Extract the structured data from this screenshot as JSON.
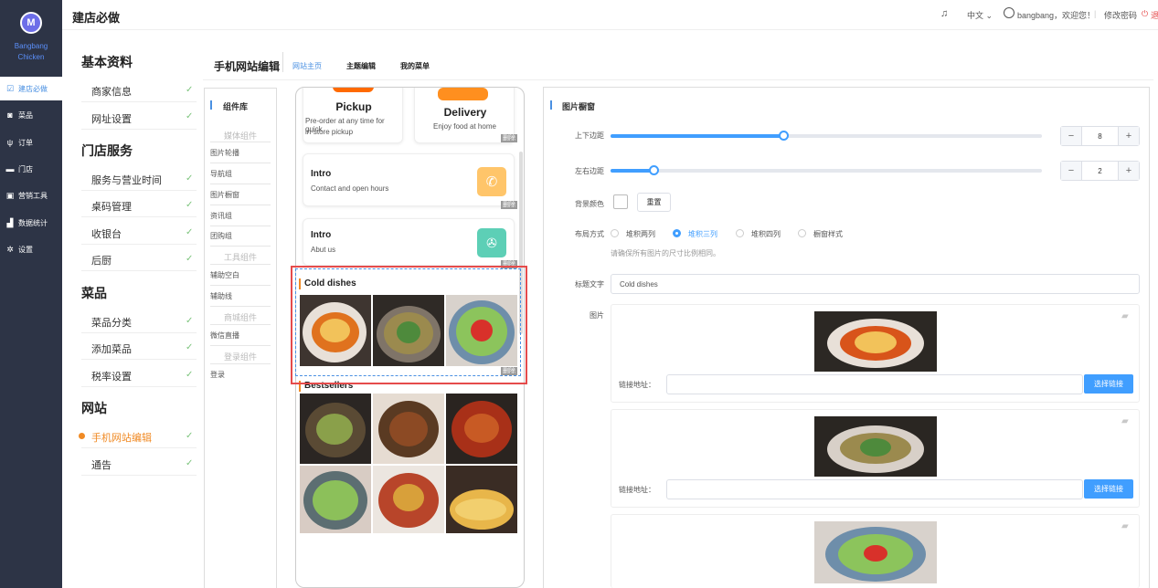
{
  "nav": {
    "brand_line1": "Bangbang",
    "brand_line2": "Chicken",
    "logo_letter": "M",
    "items": [
      {
        "icon": "check-square-icon",
        "label": "建店必做",
        "active": true
      },
      {
        "icon": "dish-icon",
        "label": "菜品"
      },
      {
        "icon": "utensils-icon",
        "label": "订单"
      },
      {
        "icon": "store-icon",
        "label": "门店"
      },
      {
        "icon": "gift-icon",
        "label": "营销工具"
      },
      {
        "icon": "chart-icon",
        "label": "数据统计"
      },
      {
        "icon": "gear-icon",
        "label": "设置"
      }
    ]
  },
  "topbar": {
    "title": "建店必做",
    "language": "中文",
    "user_greeting": "bangbang，欢迎您！",
    "change_password": "修改密码",
    "logout": "退"
  },
  "sidebar": {
    "groups": [
      {
        "title": "基本资料",
        "items": [
          "商家信息",
          "网址设置"
        ]
      },
      {
        "title": "门店服务",
        "items": [
          "服务与营业时间",
          "桌码管理",
          "收银台",
          "后厨"
        ]
      },
      {
        "title": "菜品",
        "items": [
          "菜品分类",
          "添加菜品",
          "税率设置"
        ]
      },
      {
        "title": "网站",
        "items": [
          "手机网站编辑",
          "通告"
        ]
      }
    ],
    "active_item": "手机网站编辑",
    "check": "✓"
  },
  "editor": {
    "title": "手机网站编辑",
    "tabs": [
      "网站主页",
      "主题编辑",
      "我的菜单"
    ]
  },
  "library": {
    "title": "组件库",
    "sections": [
      {
        "header": "媒体组件",
        "items": [
          "图片轮播",
          "导航组",
          "图片橱窗",
          "资讯组",
          "团购组"
        ]
      },
      {
        "header": "工具组件",
        "items": [
          "辅助空白",
          "辅助线"
        ]
      },
      {
        "header": "商城组件",
        "items": [
          "微信直播"
        ]
      },
      {
        "header": "登录组件",
        "items": [
          "登录"
        ]
      }
    ]
  },
  "phone": {
    "delete_label": "删除",
    "pickup": {
      "title": "Pickup",
      "desc1": "Pre-order at any time for quick",
      "desc2": "in-store pickup"
    },
    "delivery": {
      "title": "Delivery",
      "desc": "Enjoy food at home"
    },
    "intro1": {
      "title": "Intro",
      "desc": "Contact and open hours"
    },
    "intro2": {
      "title": "Intro",
      "desc": "Abut us"
    },
    "cold_dishes": "Cold dishes",
    "bestsellers": "Bestsellers"
  },
  "panel": {
    "title": "图片橱窗",
    "vertical_margin_label": "上下边距",
    "vertical_margin_value": "8",
    "vertical_margin_fraction": 0.08,
    "horizontal_margin_label": "左右边距",
    "horizontal_margin_value": "2",
    "horizontal_margin_fraction": 0.02,
    "minus": "−",
    "plus": "+",
    "bg_color_label": "背景颜色",
    "reset_button": "重置",
    "layout_label": "布局方式",
    "layout_options": [
      "堆积两列",
      "堆积三列",
      "堆积四列",
      "橱窗样式"
    ],
    "layout_selected": 1,
    "layout_hint": "请确保所有图片的尺寸比例相同。",
    "title_text_label": "标题文字",
    "title_text_value": "Cold dishes",
    "images_label": "图片",
    "link_address_label": "链接地址：",
    "select_link_button": "选择链接"
  },
  "colors": {
    "accent": "#409eff",
    "nav_bg": "#2d3446",
    "orange": "#f08a24",
    "selection_red": "#e54b4b"
  }
}
